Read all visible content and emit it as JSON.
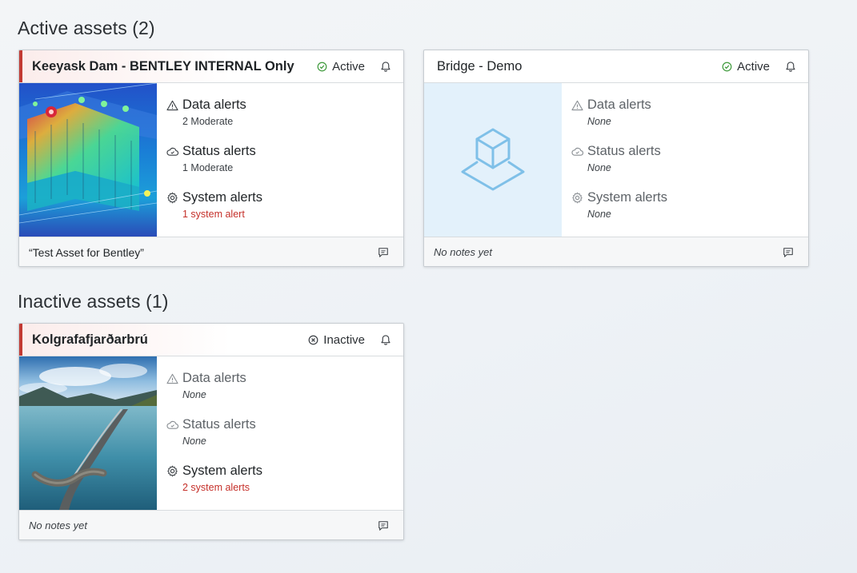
{
  "sections": {
    "active_title": "Active assets (2)",
    "inactive_title": "Inactive assets (1)"
  },
  "cards": [
    {
      "title": "Keeyask Dam - BENTLEY INTERNAL Only",
      "status": "Active",
      "data_alerts_label": "Data alerts",
      "data_alerts_value": "2 Moderate",
      "status_alerts_label": "Status alerts",
      "status_alerts_value": "1 Moderate",
      "system_alerts_label": "System alerts",
      "system_alerts_value": "1 system alert",
      "notes": "“Test Asset for Bentley”"
    },
    {
      "title": "Bridge - Demo",
      "status": "Active",
      "data_alerts_label": "Data alerts",
      "data_alerts_value": "None",
      "status_alerts_label": "Status alerts",
      "status_alerts_value": "None",
      "system_alerts_label": "System alerts",
      "system_alerts_value": "None",
      "notes": "No notes yet"
    },
    {
      "title": "Kolgrafafjarðarbrú",
      "status": "Inactive",
      "data_alerts_label": "Data alerts",
      "data_alerts_value": "None",
      "status_alerts_label": "Status alerts",
      "status_alerts_value": "None",
      "system_alerts_label": "System alerts",
      "system_alerts_value": "2 system alerts",
      "notes": "No notes yet"
    }
  ],
  "colors": {
    "flag": "#c23a33",
    "active_green": "#3f9a3c",
    "alert_red": "#c5302a",
    "placeholder_bg": "#e3f1fb",
    "placeholder_icon": "#7fc0e8"
  },
  "icons": {
    "active": "check-circle-icon",
    "inactive": "x-circle-icon",
    "notify": "bell-icon",
    "data_alerts": "warning-triangle-icon",
    "status_alerts": "cloud-icon",
    "system_alerts": "gear-icon",
    "notes": "comment-icon",
    "placeholder": "cube-icon"
  }
}
